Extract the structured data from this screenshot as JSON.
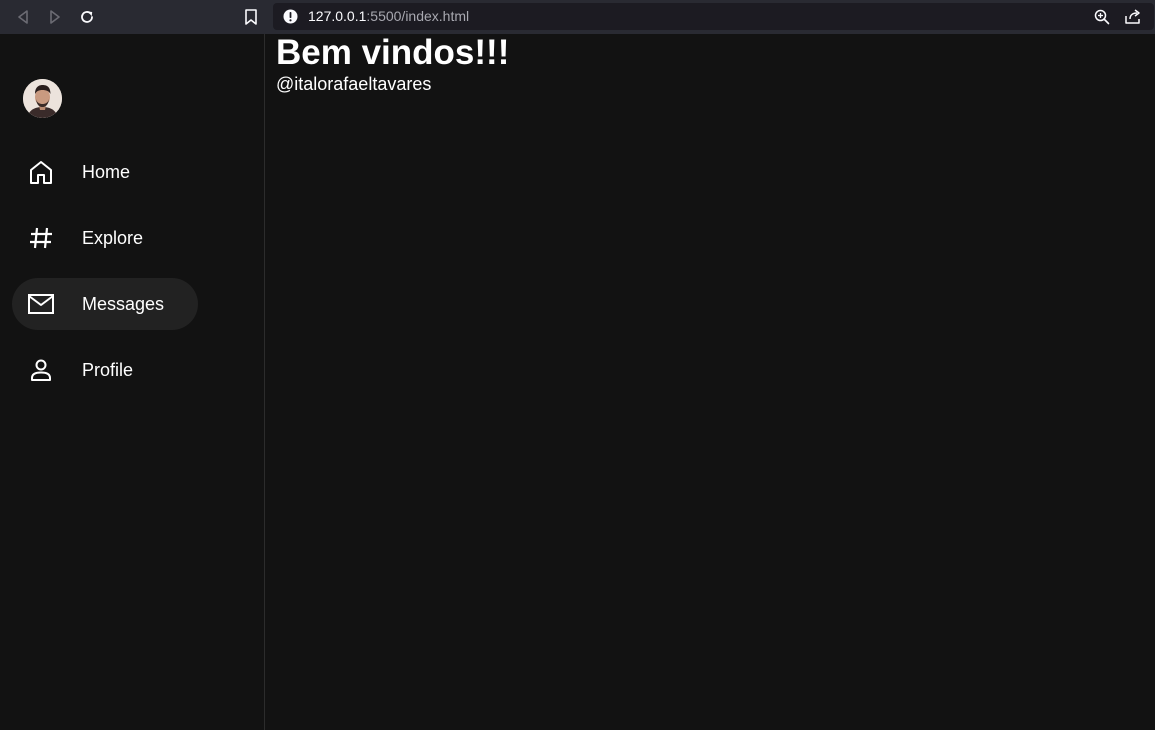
{
  "browser": {
    "url_host": "127.0.0.1",
    "url_rest": ":5500/index.html",
    "icons": {
      "back": "back-arrow-icon",
      "forward": "forward-arrow-icon",
      "reload": "reload-icon",
      "bookmark": "bookmark-icon",
      "security": "warning-icon",
      "zoom": "zoom-icon",
      "share": "share-icon"
    }
  },
  "sidebar": {
    "items": [
      {
        "label": "Home",
        "icon": "home-icon"
      },
      {
        "label": "Explore",
        "icon": "hashtag-icon"
      },
      {
        "label": "Messages",
        "icon": "mail-icon",
        "active": true
      },
      {
        "label": "Profile",
        "icon": "user-icon"
      }
    ]
  },
  "main": {
    "title": "Bem vindos!!!",
    "handle": "@italorafaeltavares"
  },
  "colors": {
    "background": "#121212",
    "toolbar": "#292a32",
    "address_bar": "#1c1b22",
    "active_item": "#222222",
    "text": "#ffffff"
  }
}
